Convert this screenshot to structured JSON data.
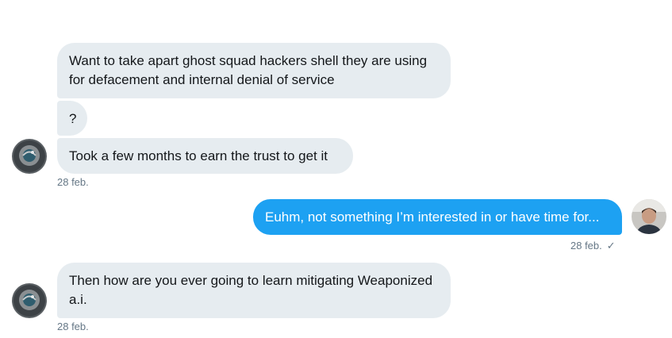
{
  "messages": [
    {
      "text": "Want to take apart ghost squad hackers shell they are using for defacement and internal denial of service"
    },
    {
      "text": "?"
    },
    {
      "text": "Took a few months to earn the trust to get it"
    },
    {
      "text": "Euhm, not something I’m interested in or have time for..."
    },
    {
      "text": "Then how are you ever going to learn mitigating Weaponized a.i."
    }
  ],
  "timestamps": {
    "group1": "28 feb.",
    "group2": "28 feb.",
    "group3": "28 feb."
  },
  "read_receipt_icon": "checkmark-icon",
  "colors": {
    "incoming_bubble": "#e6ecf0",
    "outgoing_bubble": "#1da1f2",
    "meta_text": "#657786"
  }
}
